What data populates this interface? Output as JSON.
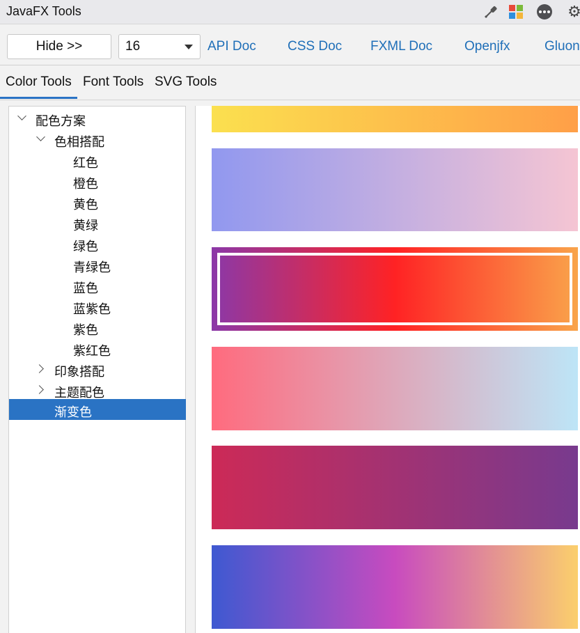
{
  "window": {
    "title": "JavaFX Tools",
    "icons": [
      "pipette-icon",
      "palette-icon",
      "more-icon",
      "gear-icon"
    ]
  },
  "toolbar": {
    "hide_label": "Hide >>",
    "font_size_value": "16",
    "links": [
      "API Doc",
      "CSS Doc",
      "FXML Doc",
      "Openjfx",
      "Gluon"
    ]
  },
  "tabs": [
    "Color Tools",
    "Font Tools",
    "SVG Tools"
  ],
  "active_tab": "Color Tools",
  "tree": {
    "root": "配色方案",
    "hue_group": "色相搭配",
    "hue_items": [
      "红色",
      "橙色",
      "黄色",
      "黄绿",
      "绿色",
      "青绿色",
      "蓝色",
      "蓝紫色",
      "紫色",
      "紫红色"
    ],
    "impression_group": "印象搭配",
    "theme_group": "主题配色",
    "gradient_item": "渐变色",
    "selected": "渐变色"
  },
  "gradients": [
    {
      "from": "#fbe04f",
      "to": "#ff9f48"
    },
    {
      "from": "#9198ef",
      "to": "#f5c5d3"
    },
    {
      "from": "#8b38a8",
      "mid": "#ff2224",
      "to": "#f9a44b",
      "selected": true
    },
    {
      "from": "#ff6b7e",
      "to": "#bde5f7"
    },
    {
      "from": "#cc2a57",
      "to": "#783a8e"
    },
    {
      "from": "#3e59d1",
      "mid": "#c84bbf",
      "to": "#fbcf6c"
    }
  ],
  "colors": {
    "accent": "#2a73c4",
    "link": "#1f6fb8"
  }
}
